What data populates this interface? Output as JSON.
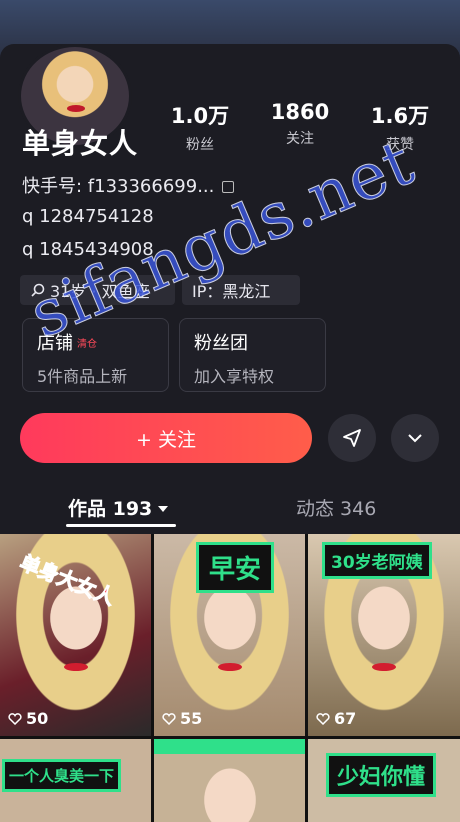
{
  "profile": {
    "name": "单身女人",
    "kuaishou_id": "快手号: f133366699...",
    "q1": "q 1284754128",
    "q2": "q 1845434908"
  },
  "stats": [
    {
      "value": "1.0万",
      "label": "粉丝"
    },
    {
      "value": "1860",
      "label": "关注"
    },
    {
      "value": "1.6万",
      "label": "获赞"
    }
  ],
  "tags": {
    "age": "31岁 · 双鱼座",
    "ip": "IP：黑龙江"
  },
  "cards": {
    "shop_title": "店铺",
    "shop_badge": "清仓",
    "shop_sub": "5件商品上新",
    "fan_title": "粉丝团",
    "fan_sub": "加入享特权"
  },
  "actions": {
    "follow": "+ 关注"
  },
  "tabs": {
    "works": "作品 193",
    "dynamic": "动态 346"
  },
  "posts": [
    {
      "caption": "单身大女人",
      "likes": "50"
    },
    {
      "caption": "早安",
      "likes": "55"
    },
    {
      "caption": "30岁老阿姨",
      "likes": "67"
    },
    {
      "caption": "一个人臭美一下",
      "likes": ""
    },
    {
      "caption": "",
      "likes": ""
    },
    {
      "caption": "少妇你懂",
      "likes": ""
    }
  ],
  "watermark": "sifangds.net",
  "colors": {
    "accent": "#ff3a5c",
    "caption_green": "#2fe08a"
  }
}
